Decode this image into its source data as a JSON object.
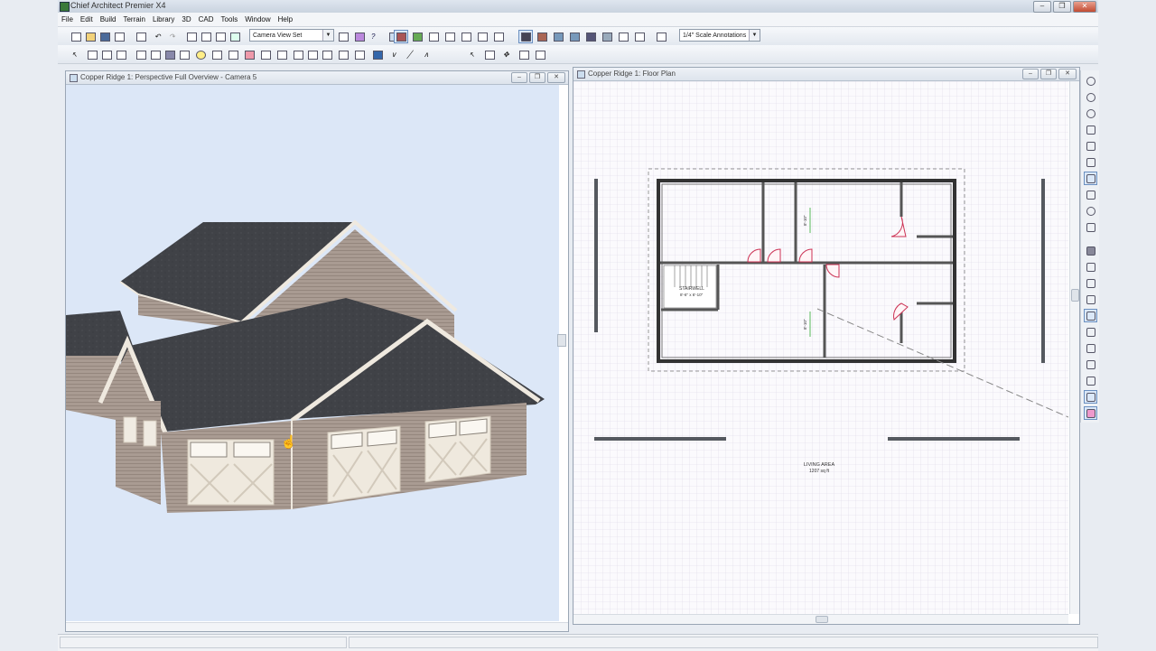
{
  "app": {
    "title": "Chief Architect Premier X4"
  },
  "menu": [
    "File",
    "Edit",
    "Build",
    "Terrain",
    "Library",
    "3D",
    "CAD",
    "Tools",
    "Window",
    "Help"
  ],
  "toolbar": {
    "camera_set": "Camera View Set",
    "scale": "1/4\" Scale Annotations"
  },
  "views": {
    "perspective_title": "Copper Ridge 1: Perspective Full Overview - Camera 5",
    "plan_title": "Copper Ridge 1: Floor Plan"
  },
  "plan": {
    "stairwell_label_1": "STAIRWELL",
    "stairwell_label_2": "8'-6\" x 6'-10\"",
    "dim_1": "8'-10\"",
    "dim_2": "8'-10\"",
    "living_area_label": "LIVING AREA",
    "living_area_value": "1207 sq ft"
  },
  "colors": {
    "sky": "#dde8f7",
    "roof": "#3f4146",
    "siding": "#a89a90",
    "trim": "#f2ece2",
    "grid": "#d9d4e2"
  },
  "icons": {
    "right_toolbar": [
      "rotate-icon",
      "zoom-in-icon",
      "zoom-out-icon",
      "fill-window-icon",
      "fit-icon",
      "undo-zoom-icon",
      "pan-icon",
      "layer-icon",
      "refresh-icon",
      "wall-icon",
      "elevation-icon",
      "cabinet-icon",
      "dimension-icon",
      "stairs-icon",
      "line-icon",
      "arc-icon",
      "grid-icon",
      "pattern-icon"
    ]
  }
}
